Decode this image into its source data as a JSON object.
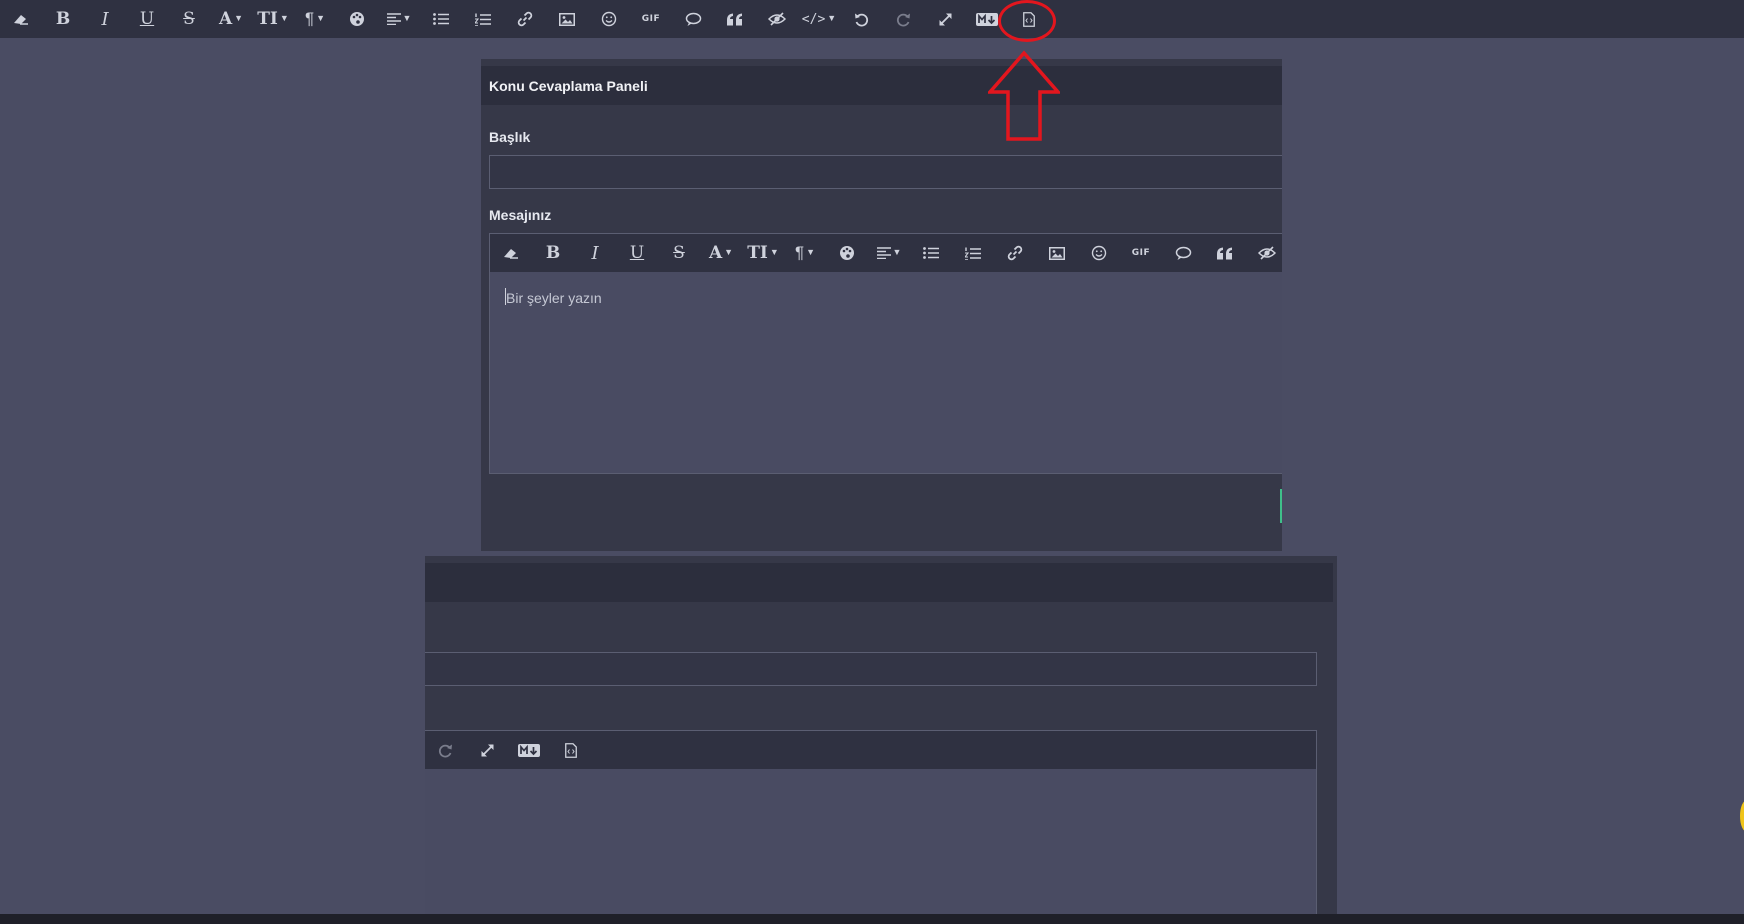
{
  "main_toolbar": {
    "items": [
      {
        "name": "eraser-icon",
        "glyph": ""
      },
      {
        "name": "bold-icon",
        "glyph": "B"
      },
      {
        "name": "italic-icon",
        "glyph": "I"
      },
      {
        "name": "underline-icon",
        "glyph": "U"
      },
      {
        "name": "strikethrough-icon",
        "glyph": "S"
      },
      {
        "name": "font-color-icon",
        "glyph": "A"
      },
      {
        "name": "font-size-icon",
        "glyph": "TI"
      },
      {
        "name": "paragraph-icon",
        "glyph": "¶"
      },
      {
        "name": "palette-icon",
        "glyph": ""
      },
      {
        "name": "align-icon",
        "glyph": ""
      },
      {
        "name": "bulleted-list-icon",
        "glyph": ""
      },
      {
        "name": "numbered-list-icon",
        "glyph": ""
      },
      {
        "name": "link-icon",
        "glyph": ""
      },
      {
        "name": "image-icon",
        "glyph": ""
      },
      {
        "name": "emoji-icon",
        "glyph": ""
      },
      {
        "name": "gif-icon",
        "glyph": "GIF"
      },
      {
        "name": "comment-icon",
        "glyph": ""
      },
      {
        "name": "quote-icon",
        "glyph": ""
      },
      {
        "name": "hide-icon",
        "glyph": ""
      },
      {
        "name": "code-icon",
        "glyph": "</>"
      },
      {
        "name": "undo-icon",
        "glyph": ""
      },
      {
        "name": "redo-icon",
        "glyph": ""
      },
      {
        "name": "fullscreen-icon",
        "glyph": ""
      },
      {
        "name": "markdown-icon",
        "glyph": "M↓"
      },
      {
        "name": "source-code-file-icon",
        "glyph": ""
      }
    ]
  },
  "reply_panel": {
    "title": "Konu Cevaplama Paneli",
    "title_label": "Başlık",
    "message_label": "Mesajınız",
    "message_placeholder": "Bir şeyler yazın"
  },
  "colors": {
    "background": "#4a4c63",
    "toolbar": "#2f3141",
    "panel": "#363848",
    "annotation": "#e3161e"
  }
}
